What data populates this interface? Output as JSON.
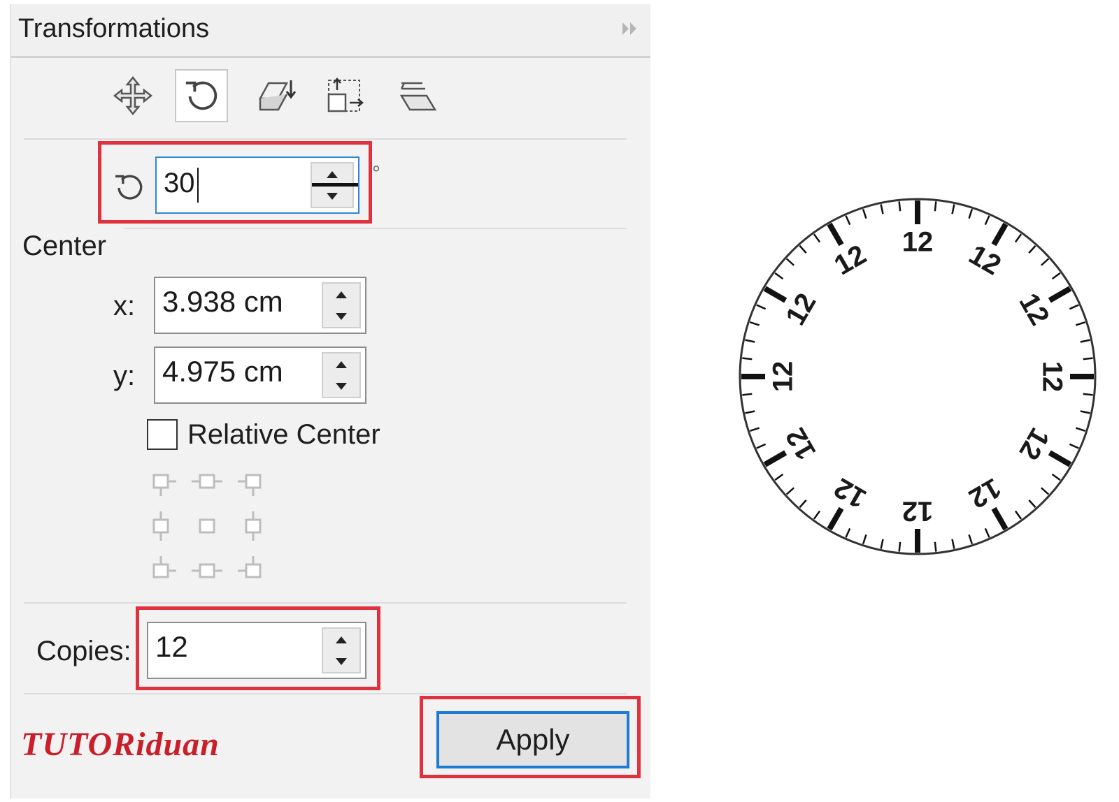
{
  "panel": {
    "title": "Transformations",
    "tools": [
      {
        "icon": "position-icon"
      },
      {
        "icon": "rotate-icon",
        "selected": true
      },
      {
        "icon": "scale-mirror-icon"
      },
      {
        "icon": "size-icon"
      },
      {
        "icon": "skew-icon"
      }
    ],
    "rotation": {
      "icon": "rotate-icon",
      "value": "30",
      "unit": "°"
    },
    "center": {
      "heading": "Center",
      "x_label": "x:",
      "x_value": "3.938 cm",
      "y_label": "y:",
      "y_value": "4.975 cm",
      "relative_label": "Relative Center",
      "relative_checked": false
    },
    "copies": {
      "label": "Copies:",
      "value": "12"
    },
    "apply_label": "Apply",
    "highlight_color": "#e0313e",
    "focus_color": "#2f86d6"
  },
  "watermark": "TUTORiduan",
  "dial": {
    "labels": [
      "12",
      "12",
      "12",
      "12",
      "12",
      "12",
      "12",
      "12",
      "12",
      "12",
      "12",
      "12"
    ]
  }
}
